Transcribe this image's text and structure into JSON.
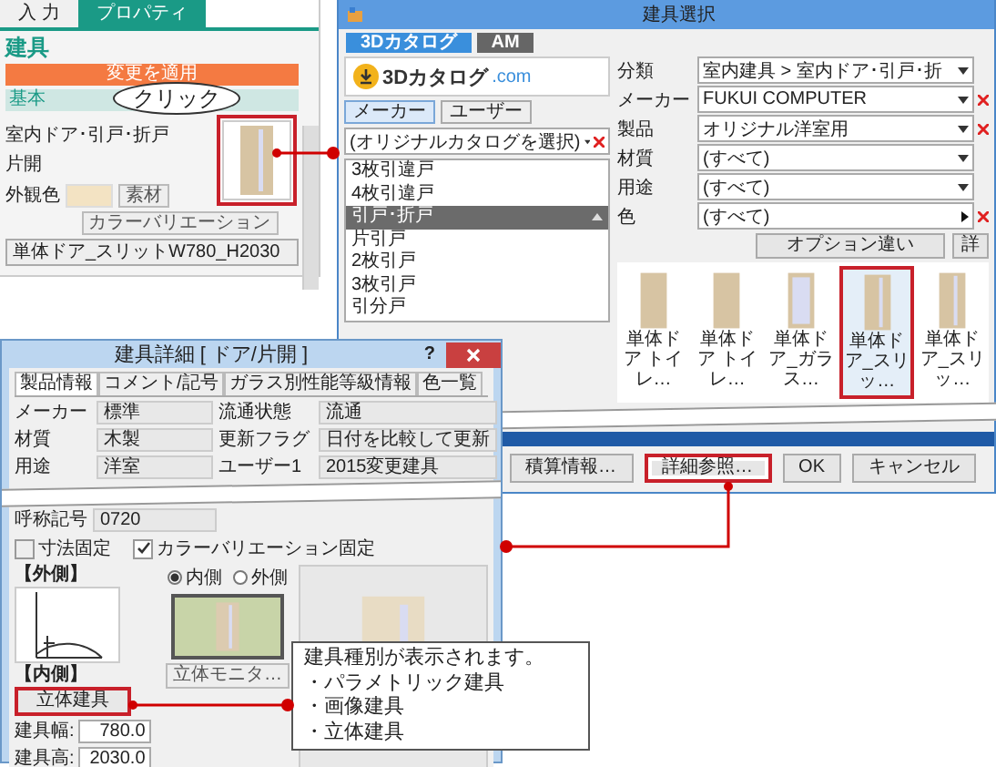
{
  "property_panel": {
    "tabs": [
      {
        "label": "入 力",
        "selected": false
      },
      {
        "label": "プロパティ",
        "selected": true
      }
    ],
    "heading": "建具",
    "apply_button": "変更を適用",
    "section": "基本",
    "rows": [
      {
        "kind": "text",
        "label": "室内ドア･引戸･折戸"
      },
      {
        "kind": "text",
        "label": "片開"
      },
      {
        "kind": "color",
        "label": "外観色",
        "button": "素材"
      }
    ],
    "variation_button": "カラーバリエーション",
    "name_field": "単体ドア_スリットW780_H2030",
    "callout": "クリック"
  },
  "select_dialog": {
    "title": "建具選択",
    "tabs": [
      {
        "label": "3Dカタログ",
        "selected": true
      },
      {
        "label": "AM",
        "selected": false
      }
    ],
    "logo": {
      "main": "3Dカタログ",
      "suffix": ".com"
    },
    "source_buttons": [
      {
        "label": "メーカー",
        "selected": true
      },
      {
        "label": "ユーザー",
        "selected": false
      }
    ],
    "catalog_dropdown": "(オリジナルカタログを選択)",
    "categories": [
      {
        "kind": "item",
        "label": "3枚引違戸"
      },
      {
        "kind": "item",
        "label": "4枚引違戸"
      },
      {
        "kind": "group",
        "label": "引戸･折戸"
      },
      {
        "kind": "item",
        "label": "片引戸"
      },
      {
        "kind": "item",
        "label": "2枚引戸"
      },
      {
        "kind": "item",
        "label": "3枚引戸"
      },
      {
        "kind": "item",
        "label": "引分戸"
      }
    ],
    "filters": [
      {
        "kind": "dropdown",
        "label": "分類",
        "value": "室内建具 > 室内ドア･引戸･折",
        "clearable": false
      },
      {
        "kind": "dropdown",
        "label": "メーカー",
        "value": "FUKUI COMPUTER",
        "clearable": true
      },
      {
        "kind": "dropdown",
        "label": "製品",
        "value": "オリジナル洋室用",
        "clearable": true
      },
      {
        "kind": "dropdown",
        "label": "材質",
        "value": "(すべて)",
        "clearable": false
      },
      {
        "kind": "dropdown",
        "label": "用途",
        "value": "(すべて)",
        "clearable": false
      },
      {
        "kind": "picker",
        "label": "色",
        "value": "(すべて)",
        "clearable": true
      }
    ],
    "option_button": "オプション違い",
    "cut_button": "詳",
    "items": [
      {
        "kind": "plain",
        "label": "単体ドア トイレ…",
        "selected": false
      },
      {
        "kind": "plain",
        "label": "単体ドア トイレ…",
        "selected": false
      },
      {
        "kind": "glass",
        "label": "単体ドア_ガラス…",
        "selected": false
      },
      {
        "kind": "slit",
        "label": "単体ドア_スリッ…",
        "selected": true
      },
      {
        "kind": "slit",
        "label": "単体ドア_スリッ…",
        "selected": false
      }
    ],
    "buttons": [
      {
        "label": "積算情報…",
        "highlighted": false
      },
      {
        "label": "詳細参照…",
        "highlighted": true
      },
      {
        "label": "OK",
        "highlighted": false
      },
      {
        "label": "キャンセル",
        "highlighted": false
      }
    ]
  },
  "detail_dialog": {
    "title": "建具詳細 [ ドア/片開 ]",
    "help": "?",
    "tabs": [
      {
        "label": "製品情報",
        "selected": true
      },
      {
        "label": "コメント/記号",
        "selected": false
      },
      {
        "label": "ガラス別性能等級情報",
        "selected": false
      },
      {
        "label": "色一覧",
        "selected": false
      }
    ],
    "fields": [
      {
        "label": "メーカー",
        "value": "標準"
      },
      {
        "label": "流通状態",
        "value": "流通"
      },
      {
        "label": "材質",
        "value": "木製"
      },
      {
        "label": "更新フラグ",
        "value": "日付を比較して更新"
      },
      {
        "label": "用途",
        "value": "洋室"
      },
      {
        "label": "ユーザー1",
        "value": "2015変更建具"
      }
    ],
    "code": {
      "label": "呼称記号",
      "value": "0720"
    },
    "checks": [
      {
        "label": "寸法固定",
        "checked": false
      },
      {
        "label": "カラーバリエーション固定",
        "checked": true
      }
    ],
    "outer_label": "【外側】",
    "radios": [
      {
        "label": "内側",
        "selected": true
      },
      {
        "label": "外側",
        "selected": false
      }
    ],
    "inner_label": "【内側】",
    "type_field": "立体建具",
    "monitor_button": "立体モニタ…",
    "sizes": [
      {
        "label": "建具幅:",
        "value": "780.0"
      },
      {
        "label": "建具高:",
        "value": "2030.0"
      }
    ]
  },
  "note": {
    "lines": [
      "建具種別が表示されます。",
      "・パラメトリック建具",
      "・画像建具",
      "・立体建具"
    ]
  }
}
